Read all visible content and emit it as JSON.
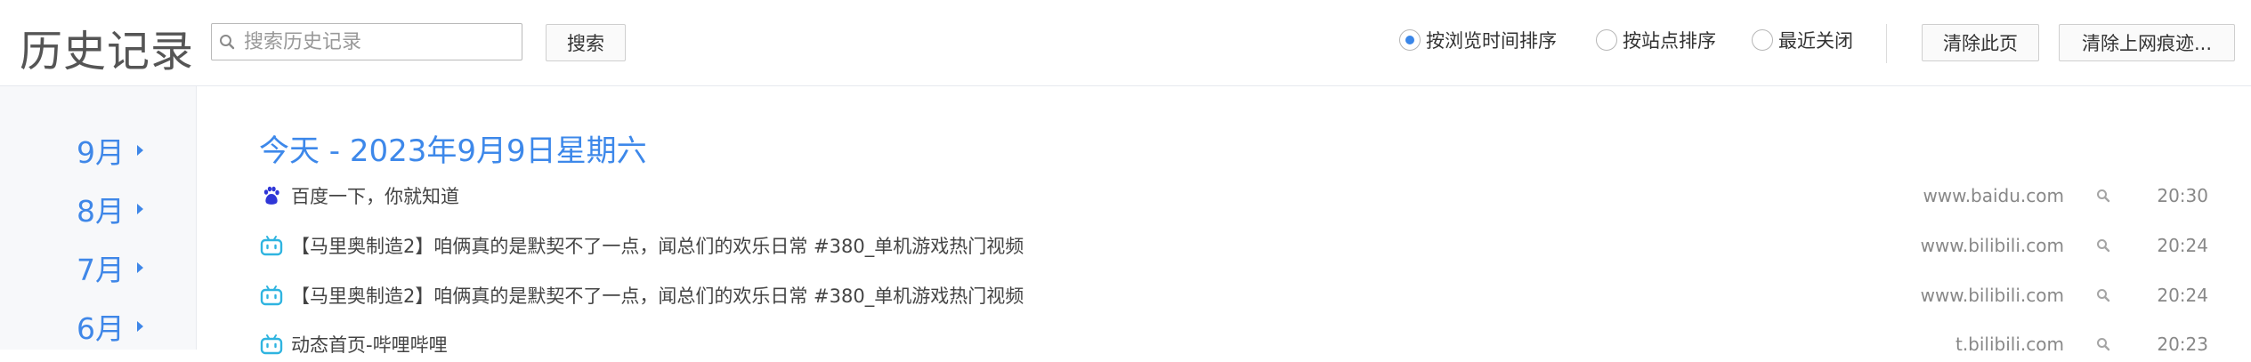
{
  "header": {
    "title": "历史记录",
    "search_placeholder": "搜索历史记录",
    "search_button": "搜索",
    "sort_options": [
      {
        "label": "按浏览时间排序",
        "selected": true
      },
      {
        "label": "按站点排序",
        "selected": false
      },
      {
        "label": "最近关闭",
        "selected": false
      }
    ],
    "clear_page_button": "清除此页",
    "clear_traces_button": "清除上网痕迹..."
  },
  "sidebar": {
    "months": [
      "9月",
      "8月",
      "7月",
      "6月"
    ]
  },
  "main": {
    "date_heading": "今天 - 2023年9月9日星期六",
    "entries": [
      {
        "icon": "baidu-icon",
        "title": "百度一下，你就知道",
        "domain": "www.baidu.com",
        "time": "20:30"
      },
      {
        "icon": "bilibili-icon",
        "title": "【马里奥制造2】咱俩真的是默契不了一点，闻总们的欢乐日常 #380_单机游戏热门视频",
        "domain": "www.bilibili.com",
        "time": "20:24"
      },
      {
        "icon": "bilibili-icon",
        "title": "【马里奥制造2】咱俩真的是默契不了一点，闻总们的欢乐日常 #380_单机游戏热门视频",
        "domain": "www.bilibili.com",
        "time": "20:24"
      },
      {
        "icon": "bilibili-icon",
        "title": "动态首页-哔哩哔哩",
        "domain": "t.bilibili.com",
        "time": "20:23"
      }
    ]
  },
  "colors": {
    "accent": "#3d88ea",
    "baidu": "#2f36d7",
    "bilibili": "#2fb4e0"
  }
}
